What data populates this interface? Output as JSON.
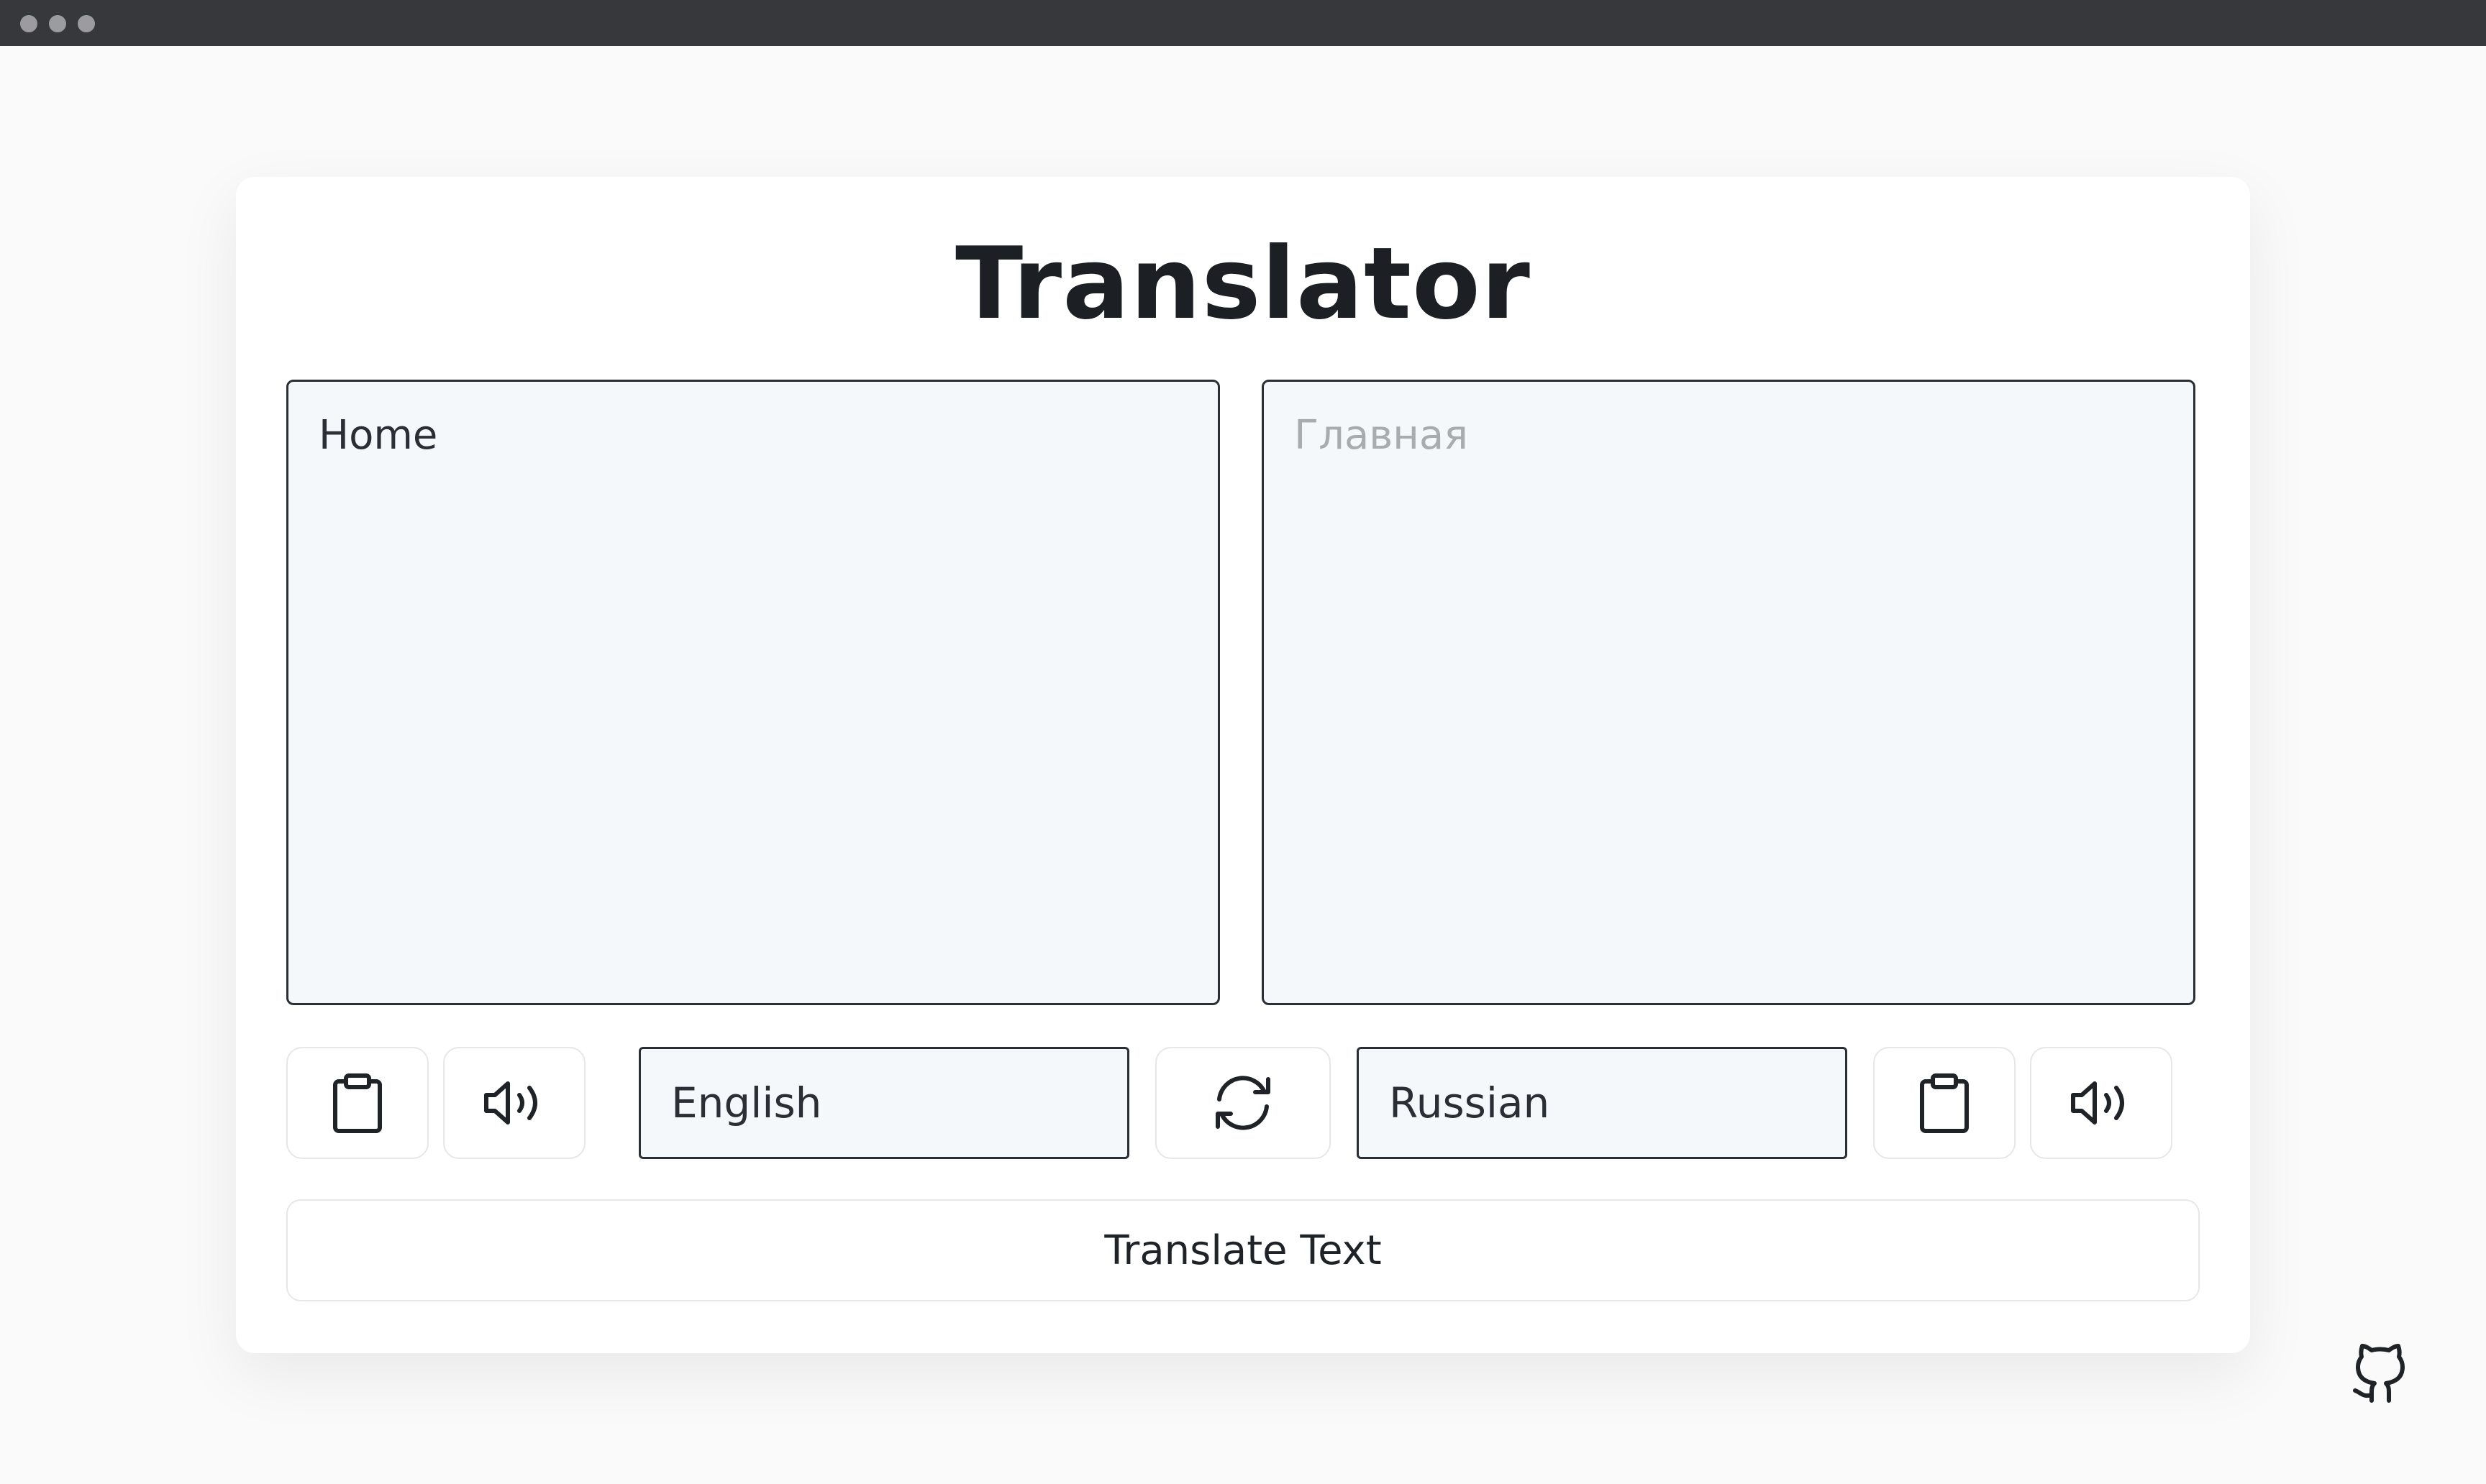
{
  "app": {
    "title": "Translator"
  },
  "source": {
    "text": "Home",
    "language": "English"
  },
  "target": {
    "placeholder": "Главная",
    "language": "Russian"
  },
  "actions": {
    "translate_label": "Translate Text"
  },
  "icons": {
    "copy": "clipboard-icon",
    "speak": "speaker-icon",
    "swap": "exchange-icon",
    "repo": "github-icon"
  },
  "colors": {
    "background": "#fafafa",
    "card": "#ffffff",
    "field": "#f5f8fb",
    "border": "#2a2e35",
    "titlebar": "#37383b"
  }
}
